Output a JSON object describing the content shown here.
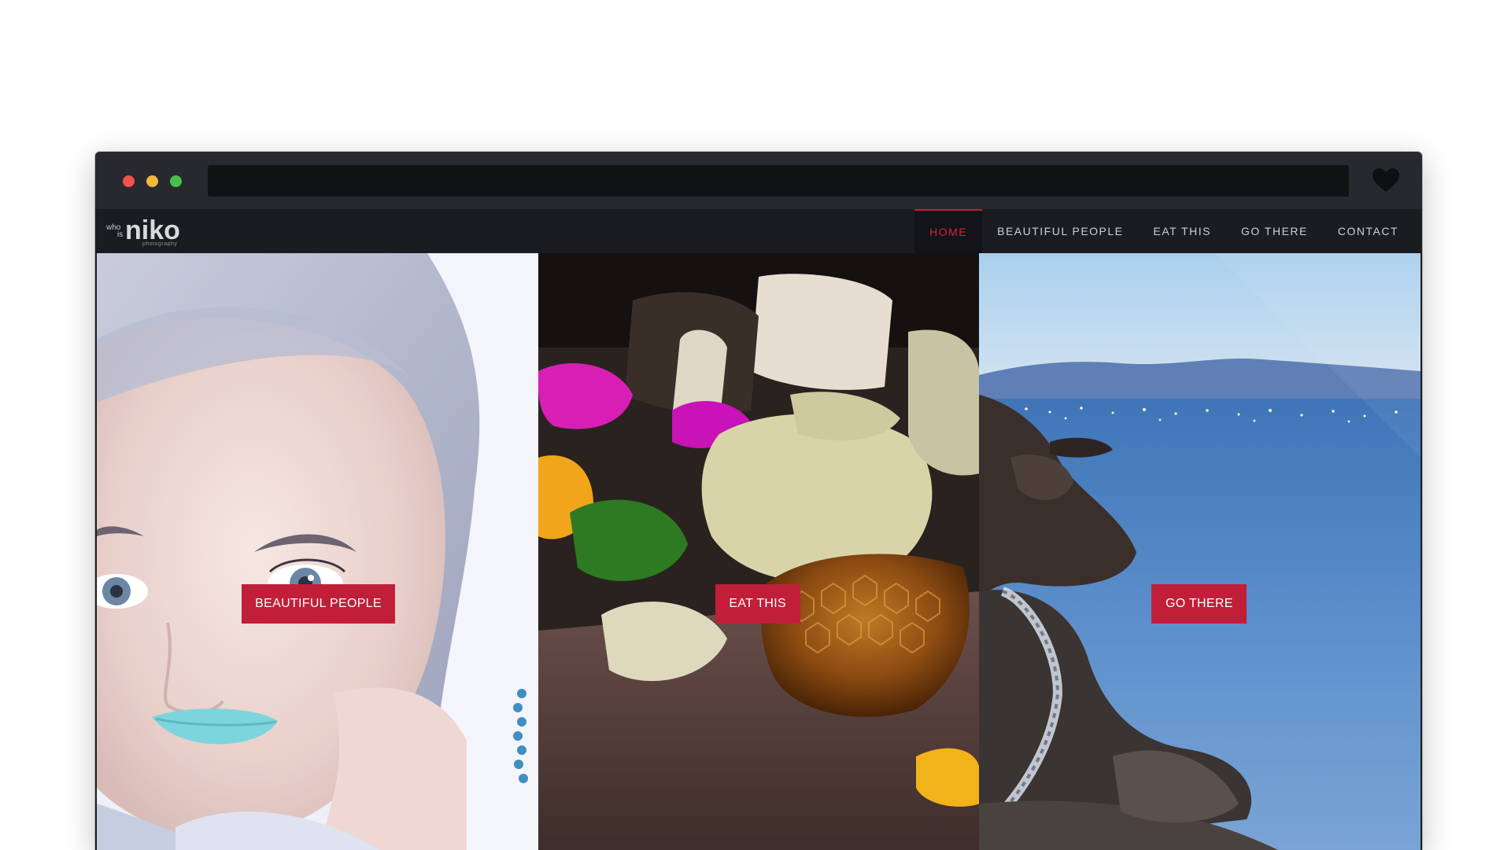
{
  "window": {
    "traffic_lights": [
      "#f2524a",
      "#f0b73a",
      "#4cbf4b"
    ],
    "address_bar": "",
    "toolbar_icon": "heart-icon"
  },
  "site": {
    "logo": {
      "prefix_top": "who",
      "prefix_bottom": "is",
      "brand": "niko",
      "tagline": "photography"
    },
    "nav": [
      {
        "label": "HOME",
        "active": true
      },
      {
        "label": "BEAUTIFUL PEOPLE",
        "active": false
      },
      {
        "label": "EAT THIS",
        "active": false
      },
      {
        "label": "GO THERE",
        "active": false
      },
      {
        "label": "CONTACT",
        "active": false
      }
    ],
    "accent_color": "#c11f39",
    "panels": [
      {
        "subject": "portrait-photo",
        "cta": "BEAUTIFUL PEOPLE"
      },
      {
        "subject": "food-photo",
        "cta": "EAT THIS"
      },
      {
        "subject": "seascape-photo",
        "cta": "GO THERE"
      }
    ]
  }
}
